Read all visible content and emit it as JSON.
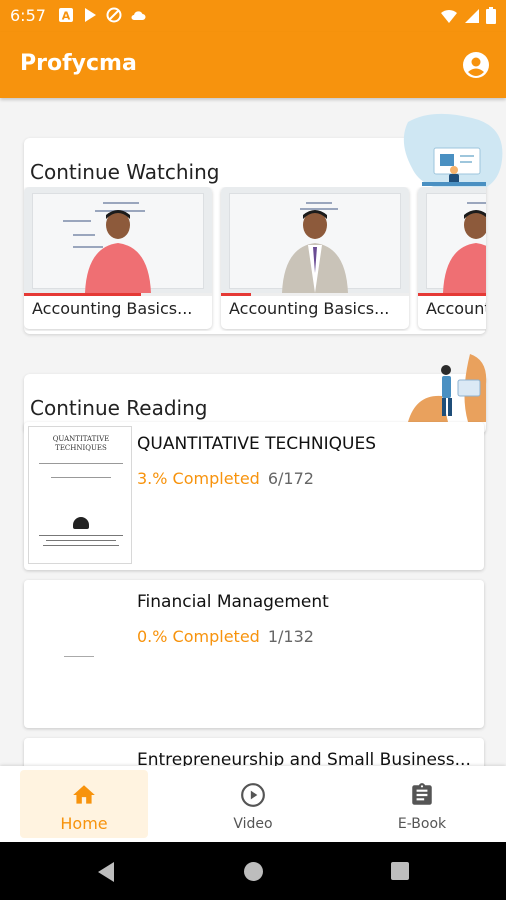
{
  "status_bar": {
    "time": "6:57",
    "left_icons": [
      "a-icon",
      "play-store-icon",
      "no-data-icon",
      "cloud-icon"
    ],
    "right_icons": [
      "wifi-icon",
      "signal-icon",
      "battery-icon"
    ]
  },
  "app_bar": {
    "title": "Profycma",
    "account_icon": "account-circle-icon"
  },
  "continue_watching": {
    "title": "Continue Watching",
    "videos": [
      {
        "label": "Accounting Basics...",
        "progress": 0.62
      },
      {
        "label": "Accounting Basics...",
        "progress": 0.16
      },
      {
        "label": "Accounting Basics...",
        "progress": 1.0
      }
    ]
  },
  "continue_reading": {
    "title": "Continue Reading",
    "books": [
      {
        "title": "QUANTITATIVE TECHNIQUES",
        "completed": "3.% Completed",
        "pages": "6/172",
        "cover_title": "QUANTITATIVE TECHNIQUES"
      },
      {
        "title": "Financial Management",
        "completed": "0.% Completed",
        "pages": "1/132"
      },
      {
        "title": "Entrepreneurship and Small Business...",
        "completed": "",
        "pages": ""
      }
    ]
  },
  "bottom_nav": {
    "items": [
      {
        "label": "Home",
        "icon": "home-icon",
        "active": true
      },
      {
        "label": "Video",
        "icon": "play-circle-icon",
        "active": false
      },
      {
        "label": "E-Book",
        "icon": "clipboard-icon",
        "active": false
      }
    ]
  },
  "colors": {
    "primary": "#f7930d",
    "progress_red": "#e53935",
    "nav_active_bg": "#fff3e0"
  }
}
